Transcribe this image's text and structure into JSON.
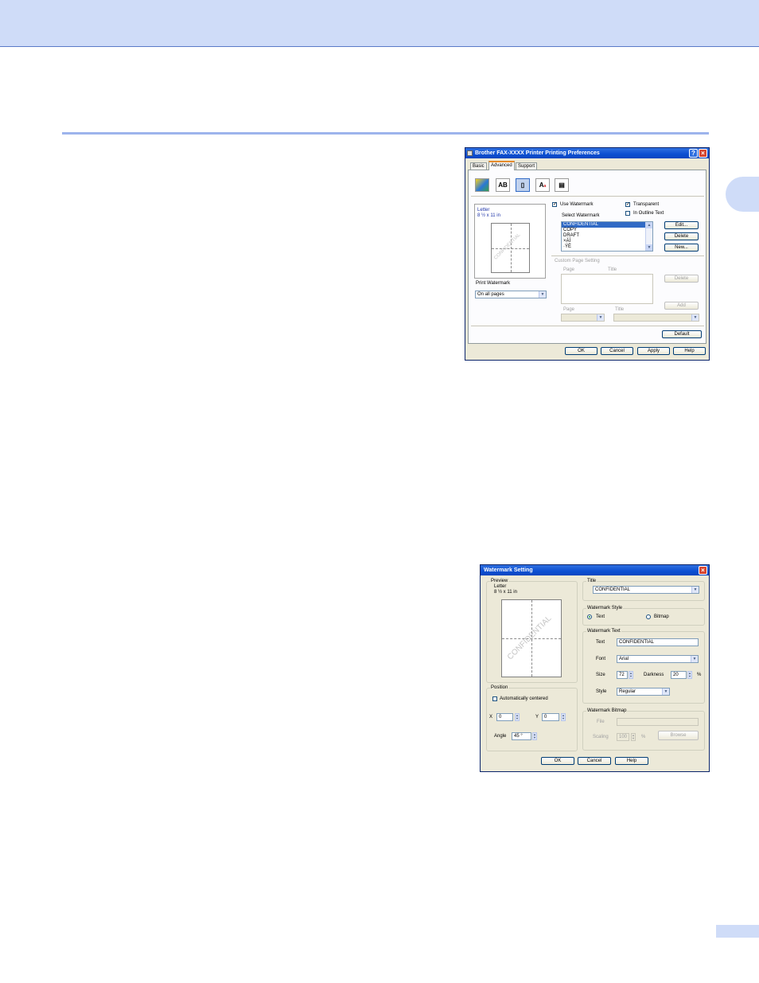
{
  "prefs_dialog": {
    "title": "Brother FAX-XXXX Printer Printing Preferences",
    "tabs": [
      "Basic",
      "Advanced",
      "Support"
    ],
    "toolbar_icons": [
      "watermark-color-icon",
      "ab-icon",
      "page-icon",
      "a-font-icon",
      "printer-settings-icon"
    ],
    "paper_label": "Letter",
    "paper_size": "8 ½ x 11 in",
    "watermark_preview": "CONFIDENTIAL",
    "use_watermark": "Use Watermark",
    "transparent": "Transparent",
    "in_outline_text": "In Outline Text",
    "select_watermark": "Select Watermark",
    "watermark_list": [
      "CONFIDENTIAL",
      "COPY",
      "DRAFT",
      "×ÄÍ",
      "·ÝÈ"
    ],
    "edit_button": "Edit...",
    "delete_button": "Delete",
    "new_button": "New...",
    "print_watermark_label": "Print Watermark",
    "print_watermark_value": "On all pages",
    "custom_page_setting": "Custom Page Setting",
    "page_col": "Page",
    "title_col": "Title",
    "custom_delete": "Delete",
    "custom_add": "Add",
    "page_label2": "Page",
    "title_label2": "Title",
    "default_button": "Default",
    "ok": "OK",
    "cancel": "Cancel",
    "apply": "Apply",
    "help": "Help"
  },
  "watermark_dialog": {
    "title": "Watermark Setting",
    "preview_group": "Preview",
    "paper_label": "Letter",
    "paper_size": "8 ½ x 11 in",
    "watermark_preview": "CONFIDENTIAL",
    "title_group": "Title",
    "title_value": "CONFIDENTIAL",
    "style_group": "Watermark Style",
    "style_text": "Text",
    "style_bitmap": "Bitmap",
    "text_group": "Watermark Text",
    "text_label": "Text",
    "text_value": "CONFIDENTIAL",
    "font_label": "Font",
    "font_value": "Arial",
    "size_label": "Size",
    "size_value": "72",
    "darkness_label": "Darkness",
    "darkness_value": "20",
    "percent": "%",
    "style_label": "Style",
    "style_value": "Regular",
    "bitmap_group": "Watermark Bitmap",
    "file_label": "File",
    "scaling_label": "Scaling",
    "scaling_value": "100",
    "scaling_percent": "%",
    "browse_button": "Browse",
    "position_group": "Position",
    "auto_center": "Automatically centered",
    "x_label": "X",
    "x_value": "0",
    "y_label": "Y",
    "y_value": "0",
    "angle_label": "Angle",
    "angle_value": "45 °",
    "ok": "OK",
    "cancel": "Cancel",
    "help": "Help"
  }
}
